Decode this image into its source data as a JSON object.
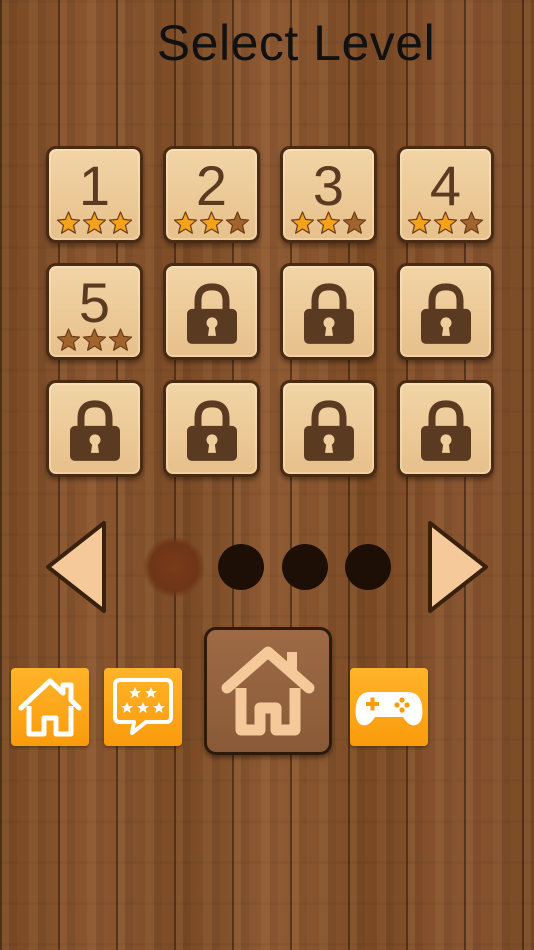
{
  "header": {
    "title": "Select Level"
  },
  "levels": [
    {
      "label": "1",
      "state": "unlocked",
      "stars_earned": 3
    },
    {
      "label": "2",
      "state": "unlocked",
      "stars_earned": 2
    },
    {
      "label": "3",
      "state": "unlocked",
      "stars_earned": 2
    },
    {
      "label": "4",
      "state": "unlocked",
      "stars_earned": 2
    },
    {
      "label": "5",
      "state": "unlocked",
      "stars_earned": 0
    },
    {
      "label": "",
      "state": "locked",
      "stars_earned": 0
    },
    {
      "label": "",
      "state": "locked",
      "stars_earned": 0
    },
    {
      "label": "",
      "state": "locked",
      "stars_earned": 0
    },
    {
      "label": "",
      "state": "locked",
      "stars_earned": 0
    },
    {
      "label": "",
      "state": "locked",
      "stars_earned": 0
    },
    {
      "label": "",
      "state": "locked",
      "stars_earned": 0
    },
    {
      "label": "",
      "state": "locked",
      "stars_earned": 0
    }
  ],
  "stars_per_level": 3,
  "pagination": {
    "pages": 4,
    "current_page": 1
  },
  "icons": {
    "prev": "left-arrow-icon",
    "next": "right-arrow-icon",
    "home": "home-icon",
    "rate": "rating-speech-bubble-icon",
    "games": "gamepad-icon",
    "lock": "padlock-icon",
    "star": "star-icon"
  },
  "colors": {
    "star_earned": "#f5a21b",
    "star_empty": "#a0642e",
    "tile_bg": "#efcd9c",
    "tile_text": "#5b3a22",
    "accent_orange": "#fca716",
    "dot_active": "#6e3517",
    "dot_inactive": "#1e0f06",
    "arrow_fill": "#f5c99a"
  }
}
